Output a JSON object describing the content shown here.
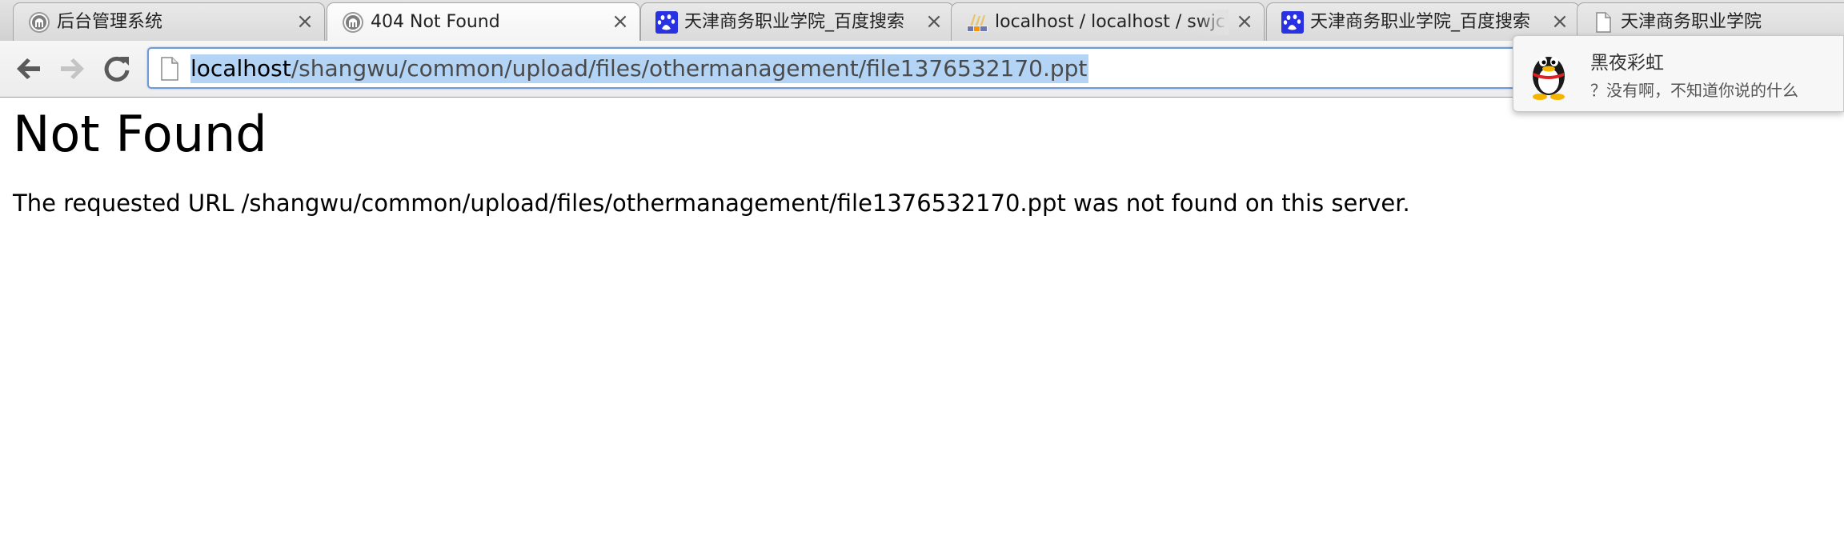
{
  "browser": {
    "tabs": [
      {
        "title": "后台管理系统",
        "icon": "apache-feather-icon"
      },
      {
        "title": "404 Not Found",
        "icon": "apache-feather-icon",
        "active": true
      },
      {
        "title": "天津商务职业学院_百度搜索",
        "icon": "baidu-paw-icon"
      },
      {
        "title": "localhost / localhost / swjc",
        "icon": "phpmyadmin-icon"
      },
      {
        "title": "天津商务职业学院_百度搜索",
        "icon": "baidu-paw-icon"
      },
      {
        "title": "天津商务职业学院",
        "icon": "blank-page-icon"
      }
    ],
    "tab_close_glyph": "×",
    "address_bar": {
      "host": "localhost",
      "path": "/shangwu/common/upload/files/othermanagement/file1376532170.ppt"
    }
  },
  "notification": {
    "sender": "黑夜彩虹",
    "message": "？没有啊，不知道你说的什么"
  },
  "page": {
    "heading": "Not Found",
    "message": "The requested URL /shangwu/common/upload/files/othermanagement/file1376532170.ppt was not found on this server."
  },
  "colors": {
    "selection": "#b4d4f5",
    "omnibox_border": "#6e9ad8",
    "baidu_blue": "#2932e1"
  }
}
